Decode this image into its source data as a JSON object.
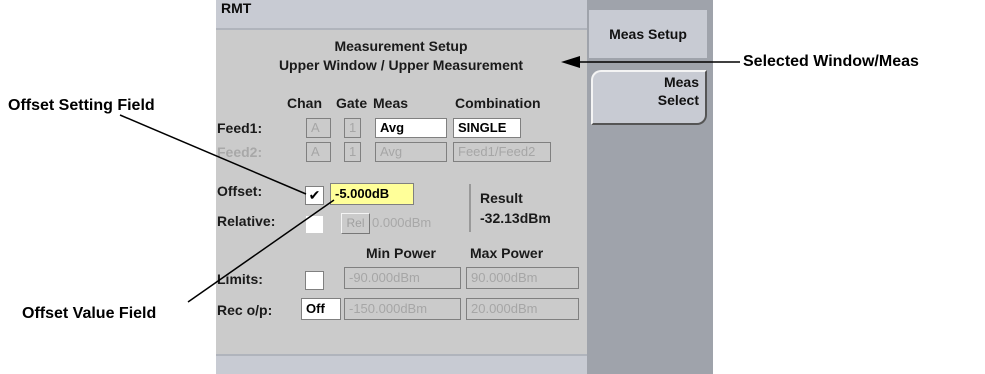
{
  "header": {
    "status": "RMT"
  },
  "title": {
    "line1": "Measurement Setup",
    "line2": "Upper Window / Upper Measurement"
  },
  "columns": {
    "chan": "Chan",
    "gate": "Gate",
    "meas": "Meas",
    "combination": "Combination"
  },
  "feed1": {
    "label": "Feed1:",
    "chan": "A",
    "gate": "1",
    "meas": "Avg",
    "combination": "SINGLE"
  },
  "feed2": {
    "label": "Feed2:",
    "chan": "A",
    "gate": "1",
    "meas": "Avg",
    "combination": "Feed1/Feed2"
  },
  "offset": {
    "label": "Offset:",
    "check": "✔",
    "value": "-5.000dB"
  },
  "result": {
    "label": "Result",
    "value": "-32.13dBm"
  },
  "relative": {
    "label": "Relative:",
    "button": "Rel",
    "value": "0.000dBm"
  },
  "limits": {
    "label": "Limits:",
    "min_header": "Min Power",
    "max_header": "Max Power",
    "min": "-90.000dBm",
    "max": "90.000dBm"
  },
  "rec": {
    "label": "Rec o/p:",
    "state": "Off",
    "min": "-150.000dBm",
    "max": "20.000dBm"
  },
  "softkeys": {
    "meas_setup": "Meas Setup",
    "meas_select_line1": "Meas",
    "meas_select_line2": "Select"
  },
  "callouts": {
    "selected_window": "Selected Window/Meas",
    "offset_setting": "Offset Setting Field",
    "offset_value": "Offset Value Field"
  },
  "colors": {
    "field_highlight": "#ffff99",
    "screen_bg": "#cbcbcb",
    "softkey_panel": "#9fa3ab"
  }
}
